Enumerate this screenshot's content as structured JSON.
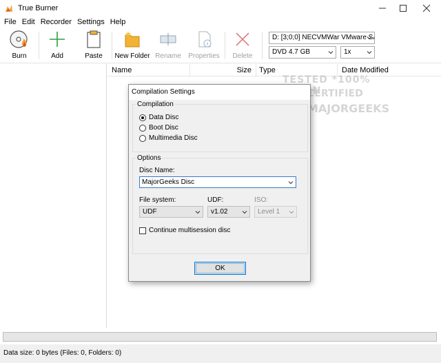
{
  "window": {
    "title": "True Burner"
  },
  "menu": [
    "File",
    "Edit",
    "Recorder",
    "Settings",
    "Help"
  ],
  "toolbar": {
    "burn": "Burn",
    "add": "Add",
    "paste": "Paste",
    "new_folder": "New Folder",
    "rename": "Rename",
    "properties": "Properties",
    "delete": "Delete",
    "drive": "D:  [3;0;0] NECVMWar VMware SA",
    "disc_type": "DVD 4.7 GB",
    "speed": "1x"
  },
  "file_list": {
    "columns": [
      "Name",
      "Size",
      "Type",
      "Date Modified"
    ]
  },
  "watermark": {
    "line1": "TESTED *100% CLEAN",
    "line2": "CERTIFIED",
    "line3": "MAJORGEEKS"
  },
  "status": {
    "text": "Data size: 0 bytes (Files: 0, Folders: 0)"
  },
  "dialog": {
    "title": "Compilation Settings",
    "compilation_group": "Compilation",
    "options": [
      "Data Disc",
      "Boot Disc",
      "Multimedia Disc"
    ],
    "selected_option": "Data Disc",
    "options_group": "Options",
    "disc_name_label": "Disc Name:",
    "disc_name_value": "MajorGeeks Disc",
    "file_system_label": "File system:",
    "file_system_value": "UDF",
    "udf_label": "UDF:",
    "udf_value": "v1.02",
    "iso_label": "ISO:",
    "iso_value": "Level 1",
    "multisession_label": "Continue multisession disc",
    "ok_label": "OK"
  },
  "colors": {
    "accent": "#0078d7",
    "add_icon": "#2e9e3e",
    "delete_icon": "#e08080",
    "folder_icon": "#f2b233"
  }
}
